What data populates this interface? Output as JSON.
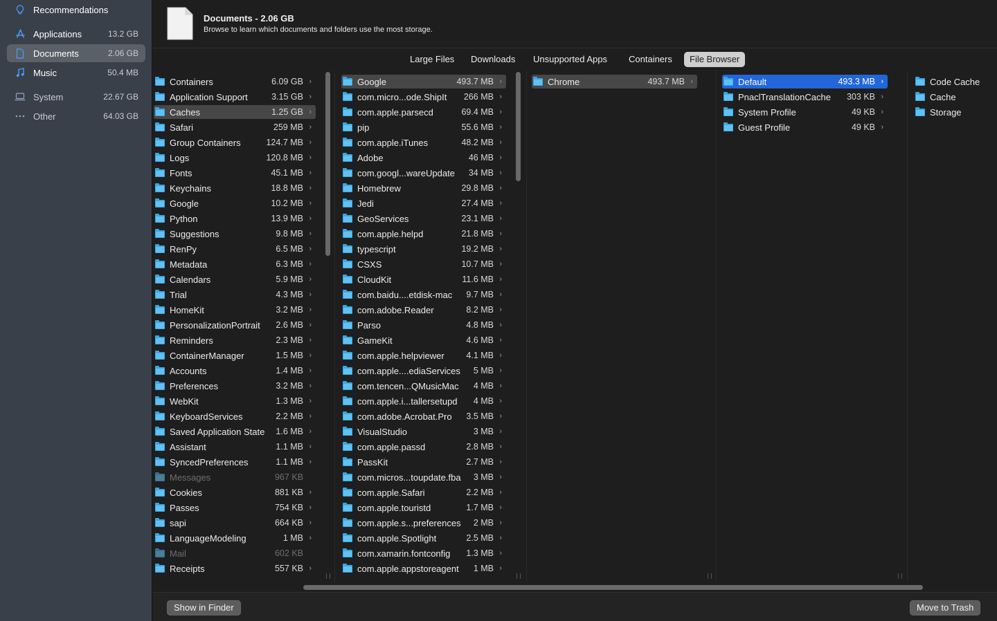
{
  "sidebar": {
    "items": [
      {
        "label": "Recommendations",
        "size": "",
        "icon": "lightbulb-icon",
        "selected": false,
        "dim": false
      },
      {
        "label": "Applications",
        "size": "13.2 GB",
        "icon": "app-store-icon",
        "selected": false,
        "dim": false
      },
      {
        "label": "Documents",
        "size": "2.06 GB",
        "icon": "document-icon",
        "selected": true,
        "dim": false
      },
      {
        "label": "Music",
        "size": "50.4 MB",
        "icon": "music-note-icon",
        "selected": false,
        "dim": false
      },
      {
        "label": "System",
        "size": "22.67 GB",
        "icon": "laptop-icon",
        "selected": false,
        "dim": true
      },
      {
        "label": "Other",
        "size": "64.03 GB",
        "icon": "ellipsis-icon",
        "selected": false,
        "dim": true
      }
    ]
  },
  "header": {
    "title": "Documents - 2.06 GB",
    "subtitle": "Browse to learn which documents and folders use the most storage."
  },
  "tabs": [
    {
      "label": "Large Files",
      "active": false
    },
    {
      "label": "Downloads",
      "active": false
    },
    {
      "label": "Unsupported Apps",
      "active": false
    },
    {
      "label": "Containers",
      "active": false
    },
    {
      "label": "File Browser",
      "active": true
    }
  ],
  "columns": [
    {
      "items": [
        {
          "name": "Containers",
          "size": "6.09 GB",
          "chevron": true
        },
        {
          "name": "Application Support",
          "size": "3.15 GB",
          "chevron": true
        },
        {
          "name": "Caches",
          "size": "1.25 GB",
          "chevron": true,
          "selected": "gray"
        },
        {
          "name": "Safari",
          "size": "259 MB",
          "chevron": true
        },
        {
          "name": "Group Containers",
          "size": "124.7 MB",
          "chevron": true
        },
        {
          "name": "Logs",
          "size": "120.8 MB",
          "chevron": true
        },
        {
          "name": "Fonts",
          "size": "45.1 MB",
          "chevron": true
        },
        {
          "name": "Keychains",
          "size": "18.8 MB",
          "chevron": true
        },
        {
          "name": "Google",
          "size": "10.2 MB",
          "chevron": true
        },
        {
          "name": "Python",
          "size": "13.9 MB",
          "chevron": true
        },
        {
          "name": "Suggestions",
          "size": "9.8 MB",
          "chevron": true
        },
        {
          "name": "RenPy",
          "size": "6.5 MB",
          "chevron": true
        },
        {
          "name": "Metadata",
          "size": "6.3 MB",
          "chevron": true
        },
        {
          "name": "Calendars",
          "size": "5.9 MB",
          "chevron": true
        },
        {
          "name": "Trial",
          "size": "4.3 MB",
          "chevron": true
        },
        {
          "name": "HomeKit",
          "size": "3.2 MB",
          "chevron": true
        },
        {
          "name": "PersonalizationPortrait",
          "size": "2.6 MB",
          "chevron": true
        },
        {
          "name": "Reminders",
          "size": "2.3 MB",
          "chevron": true
        },
        {
          "name": "ContainerManager",
          "size": "1.5 MB",
          "chevron": true
        },
        {
          "name": "Accounts",
          "size": "1.4 MB",
          "chevron": true
        },
        {
          "name": "Preferences",
          "size": "3.2 MB",
          "chevron": true
        },
        {
          "name": "WebKit",
          "size": "1.3 MB",
          "chevron": true
        },
        {
          "name": "KeyboardServices",
          "size": "2.2 MB",
          "chevron": true
        },
        {
          "name": "Saved Application State",
          "size": "1.6 MB",
          "chevron": true
        },
        {
          "name": "Assistant",
          "size": "1.1 MB",
          "chevron": true
        },
        {
          "name": "SyncedPreferences",
          "size": "1.1 MB",
          "chevron": true
        },
        {
          "name": "Messages",
          "size": "967 KB",
          "chevron": false,
          "dim": true
        },
        {
          "name": "Cookies",
          "size": "881 KB",
          "chevron": true
        },
        {
          "name": "Passes",
          "size": "754 KB",
          "chevron": true
        },
        {
          "name": "sapi",
          "size": "664 KB",
          "chevron": true
        },
        {
          "name": "LanguageModeling",
          "size": "1 MB",
          "chevron": true
        },
        {
          "name": "Mail",
          "size": "602 KB",
          "chevron": false,
          "dim": true
        },
        {
          "name": "Receipts",
          "size": "557 KB",
          "chevron": true
        }
      ]
    },
    {
      "items": [
        {
          "name": "Google",
          "size": "493.7 MB",
          "chevron": true,
          "selected": "gray"
        },
        {
          "name": "com.micro...ode.ShipIt",
          "size": "266 MB",
          "chevron": true
        },
        {
          "name": "com.apple.parsecd",
          "size": "69.4 MB",
          "chevron": true
        },
        {
          "name": "pip",
          "size": "55.6 MB",
          "chevron": true
        },
        {
          "name": "com.apple.iTunes",
          "size": "48.2 MB",
          "chevron": true
        },
        {
          "name": "Adobe",
          "size": "46 MB",
          "chevron": true
        },
        {
          "name": "com.googl...wareUpdate",
          "size": "34 MB",
          "chevron": true
        },
        {
          "name": "Homebrew",
          "size": "29.8 MB",
          "chevron": true
        },
        {
          "name": "Jedi",
          "size": "27.4 MB",
          "chevron": true
        },
        {
          "name": "GeoServices",
          "size": "23.1 MB",
          "chevron": true
        },
        {
          "name": "com.apple.helpd",
          "size": "21.8 MB",
          "chevron": true
        },
        {
          "name": "typescript",
          "size": "19.2 MB",
          "chevron": true
        },
        {
          "name": "CSXS",
          "size": "10.7 MB",
          "chevron": true
        },
        {
          "name": "CloudKit",
          "size": "11.6 MB",
          "chevron": true
        },
        {
          "name": "com.baidu....etdisk-mac",
          "size": "9.7 MB",
          "chevron": true
        },
        {
          "name": "com.adobe.Reader",
          "size": "8.2 MB",
          "chevron": true
        },
        {
          "name": "Parso",
          "size": "4.8 MB",
          "chevron": true
        },
        {
          "name": "GameKit",
          "size": "4.6 MB",
          "chevron": true
        },
        {
          "name": "com.apple.helpviewer",
          "size": "4.1 MB",
          "chevron": true
        },
        {
          "name": "com.apple....ediaServices",
          "size": "5 MB",
          "chevron": true
        },
        {
          "name": "com.tencen...QMusicMac",
          "size": "4 MB",
          "chevron": true
        },
        {
          "name": "com.apple.i...tallersetupd",
          "size": "4 MB",
          "chevron": true
        },
        {
          "name": "com.adobe.Acrobat.Pro",
          "size": "3.5 MB",
          "chevron": true
        },
        {
          "name": "VisualStudio",
          "size": "3 MB",
          "chevron": true
        },
        {
          "name": "com.apple.passd",
          "size": "2.8 MB",
          "chevron": true
        },
        {
          "name": "PassKit",
          "size": "2.7 MB",
          "chevron": true
        },
        {
          "name": "com.micros...toupdate.fba",
          "size": "3 MB",
          "chevron": true
        },
        {
          "name": "com.apple.Safari",
          "size": "2.2 MB",
          "chevron": true
        },
        {
          "name": "com.apple.touristd",
          "size": "1.7 MB",
          "chevron": true
        },
        {
          "name": "com.apple.s...preferences",
          "size": "2 MB",
          "chevron": true
        },
        {
          "name": "com.apple.Spotlight",
          "size": "2.5 MB",
          "chevron": true
        },
        {
          "name": "com.xamarin.fontconfig",
          "size": "1.3 MB",
          "chevron": true
        },
        {
          "name": "com.apple.appstoreagent",
          "size": "1 MB",
          "chevron": true
        }
      ]
    },
    {
      "items": [
        {
          "name": "Chrome",
          "size": "493.7 MB",
          "chevron": true,
          "selected": "gray"
        }
      ]
    },
    {
      "items": [
        {
          "name": "Default",
          "size": "493.3 MB",
          "chevron": true,
          "selected": "blue"
        },
        {
          "name": "PnaclTranslationCache",
          "size": "303 KB",
          "chevron": true
        },
        {
          "name": "System Profile",
          "size": "49 KB",
          "chevron": true
        },
        {
          "name": "Guest Profile",
          "size": "49 KB",
          "chevron": true
        }
      ]
    },
    {
      "items": [
        {
          "name": "Code Cache",
          "size": "",
          "chevron": false
        },
        {
          "name": "Cache",
          "size": "",
          "chevron": false
        },
        {
          "name": "Storage",
          "size": "",
          "chevron": false
        }
      ]
    }
  ],
  "footer": {
    "show_in_finder": "Show in Finder",
    "move_to_trash": "Move to Trash"
  },
  "colors": {
    "selection_blue": "#2266d9",
    "folder_blue": "#37a8e6",
    "sidebar_bg": "#39404a",
    "accent": "#4d9bff"
  }
}
